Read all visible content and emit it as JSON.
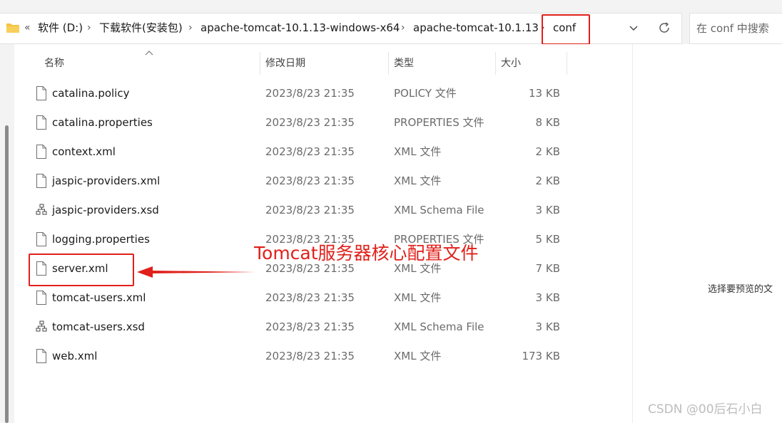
{
  "breadcrumb": {
    "overflow": "«",
    "items": [
      "软件 (D:)",
      "下载软件(安装包)",
      "apache-tomcat-10.1.13-windows-x64",
      "apache-tomcat-10.1.13",
      "conf"
    ],
    "separator": "›"
  },
  "search": {
    "placeholder": "在 conf 中搜索"
  },
  "columns": {
    "name": "名称",
    "date": "修改日期",
    "type": "类型",
    "size": "大小"
  },
  "files": [
    {
      "name": "catalina.policy",
      "date": "2023/8/23 21:35",
      "type": "POLICY 文件",
      "size": "13 KB",
      "icon": "file-icon"
    },
    {
      "name": "catalina.properties",
      "date": "2023/8/23 21:35",
      "type": "PROPERTIES 文件",
      "size": "8 KB",
      "icon": "file-icon"
    },
    {
      "name": "context.xml",
      "date": "2023/8/23 21:35",
      "type": "XML 文件",
      "size": "2 KB",
      "icon": "file-icon"
    },
    {
      "name": "jaspic-providers.xml",
      "date": "2023/8/23 21:35",
      "type": "XML 文件",
      "size": "2 KB",
      "icon": "file-icon"
    },
    {
      "name": "jaspic-providers.xsd",
      "date": "2023/8/23 21:35",
      "type": "XML Schema File",
      "size": "3 KB",
      "icon": "schema-file-icon"
    },
    {
      "name": "logging.properties",
      "date": "2023/8/23 21:35",
      "type": "PROPERTIES 文件",
      "size": "5 KB",
      "icon": "file-icon"
    },
    {
      "name": "server.xml",
      "date": "2023/8/23 21:35",
      "type": "XML 文件",
      "size": "7 KB",
      "icon": "file-icon"
    },
    {
      "name": "tomcat-users.xml",
      "date": "2023/8/23 21:35",
      "type": "XML 文件",
      "size": "3 KB",
      "icon": "file-icon"
    },
    {
      "name": "tomcat-users.xsd",
      "date": "2023/8/23 21:35",
      "type": "XML Schema File",
      "size": "3 KB",
      "icon": "schema-file-icon"
    },
    {
      "name": "web.xml",
      "date": "2023/8/23 21:35",
      "type": "XML 文件",
      "size": "173 KB",
      "icon": "file-icon"
    }
  ],
  "annotation": {
    "text": "Tomcat服务器核心配置文件",
    "color": "#e0201a"
  },
  "preview": {
    "text": "选择要预览的文"
  },
  "watermark": "CSDN @00后石小白",
  "colors": {
    "folder": "#f5c342",
    "annotation": "#e0201a"
  }
}
